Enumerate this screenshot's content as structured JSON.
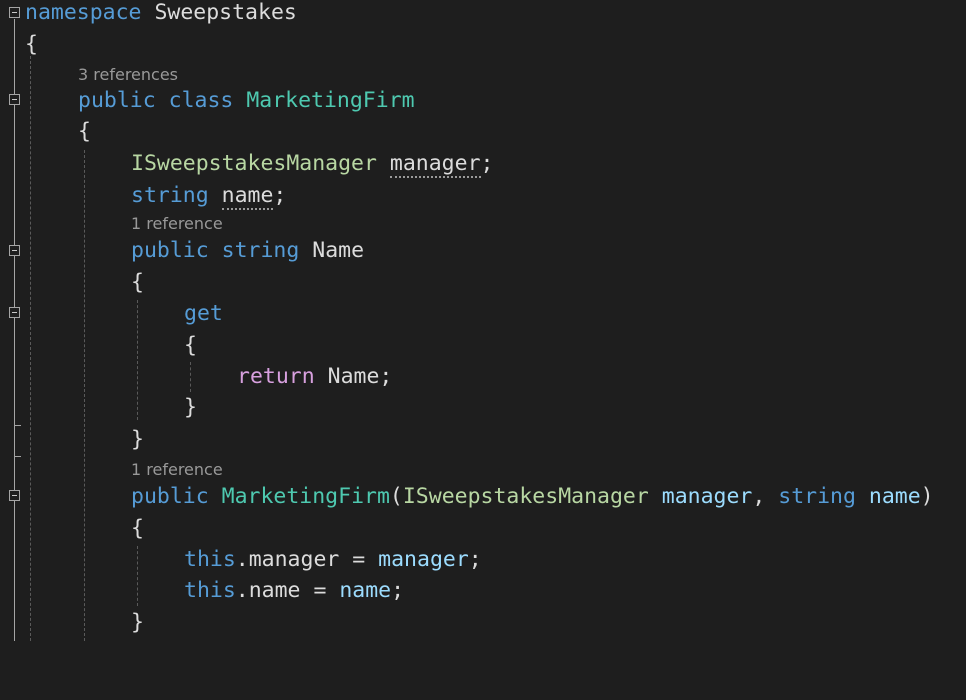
{
  "editor": {
    "colors": {
      "background": "#1e1e1e",
      "keyword": "#569cd6",
      "control_keyword": "#d8a0df",
      "type": "#4ec9b0",
      "interface": "#b8d7a3",
      "parameter": "#9cdcfe",
      "plain": "#dcdcdc",
      "codelens": "#999999"
    },
    "codelens": {
      "class_refs": "3 references",
      "name_refs": "1 reference",
      "ctor_refs": "1 reference"
    },
    "tokens": {
      "namespace": "namespace",
      "namespace_name": "Sweepstakes",
      "open_brace": "{",
      "close_brace": "}",
      "public": "public",
      "class": "class",
      "class_name": "MarketingFirm",
      "interface_type": "ISweepstakesManager",
      "field_manager": "manager",
      "semicolon": ";",
      "string": "string",
      "field_name": "name",
      "prop_name": "Name",
      "get": "get",
      "return": "return",
      "return_expr": "Name;",
      "ctor_name": "MarketingFirm",
      "open_paren": "(",
      "param_manager": "manager",
      "comma": ", ",
      "param_name": "name",
      "close_paren": ")",
      "this": "this",
      "dot_manager": ".manager = ",
      "dot_name": ".name = "
    },
    "icons": [
      "fold-collapse-icon"
    ]
  }
}
